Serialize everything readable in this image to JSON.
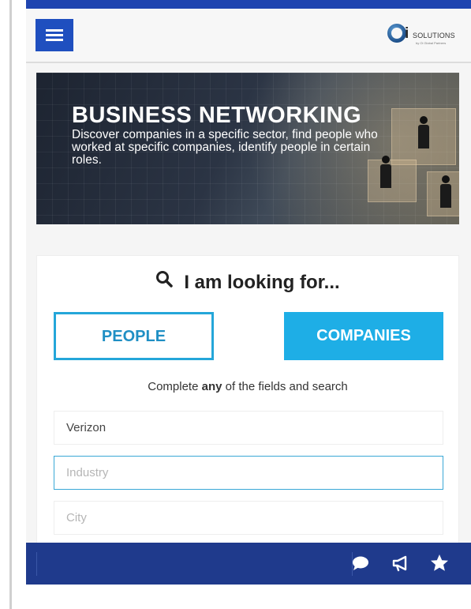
{
  "header": {
    "logo_letter": "i",
    "logo_text": "SOLUTIONS",
    "logo_subtext": "by Oi Global Partners"
  },
  "banner": {
    "title": "BUSINESS NETWORKING",
    "description": "Discover companies in a specific sector, find people who worked at specific companies, identify people in certain roles."
  },
  "search": {
    "heading": "I am looking for...",
    "tabs": [
      {
        "label": "PEOPLE",
        "selected": false
      },
      {
        "label": "COMPANIES",
        "selected": true
      }
    ],
    "hint_prefix": "Complete ",
    "hint_bold": "any",
    "hint_suffix": " of the fields and search",
    "fields": [
      {
        "value": "Verizon",
        "placeholder": ""
      },
      {
        "value": "",
        "placeholder": "Industry"
      },
      {
        "value": "",
        "placeholder": "City"
      }
    ]
  },
  "bottom_bar": {
    "icons": [
      "chat-icon",
      "megaphone-icon",
      "star-icon"
    ]
  },
  "colors": {
    "accent": "#1eaee6",
    "nav_blue": "#1f3a8c",
    "menu_blue": "#1f4fbf"
  }
}
